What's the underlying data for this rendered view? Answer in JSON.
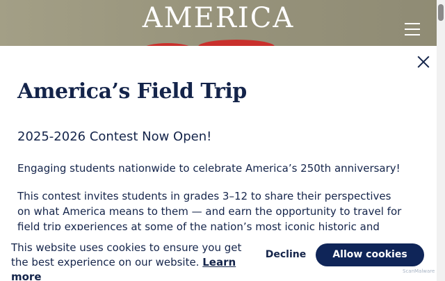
{
  "header": {
    "brand": "AMERICA",
    "menu_icon": "hamburger-menu-icon"
  },
  "modal": {
    "title": "America’s Field Trip",
    "subtitle": "2025-2026 Contest Now Open!",
    "paragraph1": "Engaging students nationwide to celebrate America’s 250th anniversary!",
    "paragraph2": "This contest invites students in grades 3–12 to share their perspectives on what America means to them — and earn the opportunity to travel for field trip experiences at some of the nation’s most iconic historic and cultural landmarks.",
    "close_icon": "close-icon"
  },
  "cookie_banner": {
    "text": "This website uses cookies to ensure you get the best experience on our website.",
    "learn_more": "Learn more",
    "decline_label": "Decline",
    "allow_label": "Allow cookies",
    "watermark": "ScanMalware"
  },
  "colors": {
    "navy": "#14244a",
    "button_navy": "#0f2558",
    "header_bg": "#97937b",
    "accent_red": "#c9302c"
  }
}
